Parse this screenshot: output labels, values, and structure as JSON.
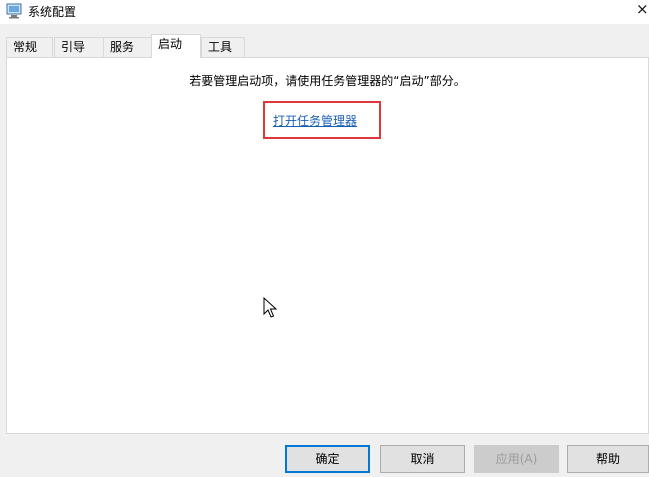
{
  "window": {
    "title": "系统配置",
    "close_glyph": "×",
    "app_icon": "system-config-icon"
  },
  "tabs": [
    {
      "label": "常规",
      "active": false
    },
    {
      "label": "引导",
      "active": false
    },
    {
      "label": "服务",
      "active": false
    },
    {
      "label": "启动",
      "active": true
    },
    {
      "label": "工具",
      "active": false
    }
  ],
  "startup": {
    "instruction": "若要管理启动项，请使用任务管理器的“启动”部分。",
    "link_label": "打开任务管理器",
    "highlight_color": "#e0373b"
  },
  "buttons": {
    "ok": "确定",
    "cancel": "取消",
    "apply": "应用(A)",
    "help": "帮助"
  },
  "accent_color": "#0078d7"
}
